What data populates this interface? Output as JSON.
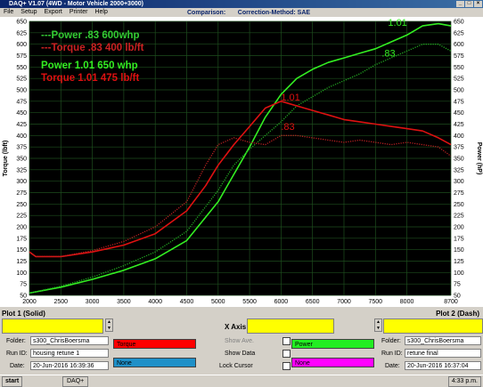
{
  "window": {
    "title": "DAQ+ V1.07 (4WD - Motor Vehicle 2000+3000)",
    "comparison_label": "Comparison:",
    "correction_label": "Correction-Method: SAE",
    "menu": [
      "File",
      "Setup",
      "Export",
      "Printer",
      "Help"
    ]
  },
  "chart_data": {
    "type": "line",
    "x_ticks": [
      2000,
      2500,
      3000,
      3500,
      4000,
      4500,
      5000,
      5500,
      6000,
      6500,
      7000,
      7500,
      8000,
      8700
    ],
    "xlim": [
      2000,
      8700
    ],
    "y_ticks": [
      50,
      75,
      100,
      125,
      150,
      175,
      200,
      225,
      250,
      275,
      300,
      325,
      350,
      375,
      400,
      425,
      450,
      475,
      500,
      525,
      550,
      575,
      600,
      625,
      650
    ],
    "ylim": [
      50,
      650
    ],
    "ylabel_left": "Torque (lbft)",
    "ylabel_right": "Power (hP)",
    "legend": [
      {
        "label": "---Power .83 600whp",
        "color": "#33cc33",
        "style": "dotted"
      },
      {
        "label": "---Torque .83 400 lb/ft",
        "color": "#cc2222",
        "style": "dotted"
      },
      {
        "label": "Power 1.01 650 whp",
        "color": "#33ee22",
        "style": "solid"
      },
      {
        "label": "Torque 1.01 475 lb/ft",
        "color": "#dd1111",
        "style": "solid"
      }
    ],
    "annotations": [
      {
        "text": "1.01",
        "x": 7700,
        "y": 640,
        "color": "#33ee22"
      },
      {
        "text": ".83",
        "x": 7600,
        "y": 573,
        "color": "#33ee22"
      },
      {
        "text": "1.01",
        "x": 6000,
        "y": 477,
        "color": "#dd1111"
      },
      {
        "text": ".83",
        "x": 6000,
        "y": 412,
        "color": "#dd1111"
      }
    ],
    "series": [
      {
        "legend_index": 2,
        "color": "#33ee22",
        "dash": "",
        "x": [
          2000,
          2500,
          3000,
          3500,
          4000,
          4500,
          5000,
          5250,
          5500,
          5750,
          6000,
          6250,
          6500,
          6750,
          7000,
          7250,
          7500,
          7750,
          8000,
          8250,
          8500,
          8700
        ],
        "y": [
          55,
          68,
          85,
          105,
          130,
          170,
          255,
          315,
          375,
          440,
          490,
          525,
          545,
          560,
          570,
          580,
          590,
          605,
          620,
          640,
          645,
          640
        ]
      },
      {
        "legend_index": 0,
        "color": "#22aa22",
        "dash": "1.2,1.4",
        "x": [
          2000,
          2500,
          3000,
          3500,
          4000,
          4500,
          5000,
          5250,
          5500,
          5750,
          6000,
          6250,
          6500,
          6750,
          7000,
          7250,
          7500,
          7750,
          8000,
          8250,
          8500,
          8700
        ],
        "y": [
          55,
          70,
          90,
          115,
          145,
          190,
          280,
          335,
          370,
          400,
          430,
          465,
          485,
          505,
          520,
          535,
          555,
          570,
          585,
          600,
          600,
          585
        ]
      },
      {
        "legend_index": 3,
        "color": "#dd1111",
        "dash": "",
        "x": [
          2000,
          2100,
          2500,
          3000,
          3500,
          4000,
          4500,
          4800,
          5000,
          5250,
          5500,
          5750,
          6000,
          6250,
          6500,
          6750,
          7000,
          7250,
          7500,
          7750,
          8000,
          8250,
          8500,
          8700
        ],
        "y": [
          145,
          135,
          135,
          145,
          160,
          185,
          235,
          290,
          335,
          380,
          420,
          460,
          475,
          465,
          455,
          445,
          435,
          430,
          425,
          420,
          415,
          410,
          395,
          380
        ]
      },
      {
        "legend_index": 1,
        "color": "#bb2222",
        "dash": "1.2,1.4",
        "x": [
          2000,
          2100,
          2500,
          3000,
          3500,
          4000,
          4500,
          4800,
          5000,
          5250,
          5500,
          5750,
          6000,
          6250,
          6500,
          6750,
          7000,
          7250,
          7500,
          7750,
          8000,
          8250,
          8500,
          8700
        ],
        "y": [
          145,
          135,
          135,
          148,
          168,
          200,
          255,
          335,
          380,
          395,
          385,
          380,
          400,
          400,
          395,
          390,
          385,
          390,
          385,
          380,
          385,
          380,
          375,
          355
        ]
      }
    ]
  },
  "panel": {
    "plot1_title": "Plot 1 (Solid)",
    "xaxis_title": "X Axis",
    "plot2_title": "Plot 2 (Dash)",
    "folder_label": "Folder:",
    "runid_label": "Run ID:",
    "date_label": "Date:",
    "plot1_folder": "s300_ChrisBoersma",
    "plot1_runid": "housing retune 1",
    "plot1_date": "20-Jun-2016 16:39:36",
    "plot2_folder": "s300_ChrisBoersma",
    "plot2_runid": "retune final",
    "plot2_date": "20-Jun-2016 16:37:04",
    "ch1": "Torque",
    "ch2": "None",
    "ch3": "Power",
    "ch4": "None",
    "show_ave": "Show Ave.",
    "show_data": "Show Data",
    "lock_cursor": "Lock Cursor",
    "colors": {
      "torque": "#ff0000",
      "none_left": "#1e90c8",
      "power": "#22ee22",
      "none_right": "#ff00ff"
    }
  },
  "taskbar": {
    "start_label": "start",
    "task_label": "DAQ+",
    "clock": "4:33 p.m."
  }
}
